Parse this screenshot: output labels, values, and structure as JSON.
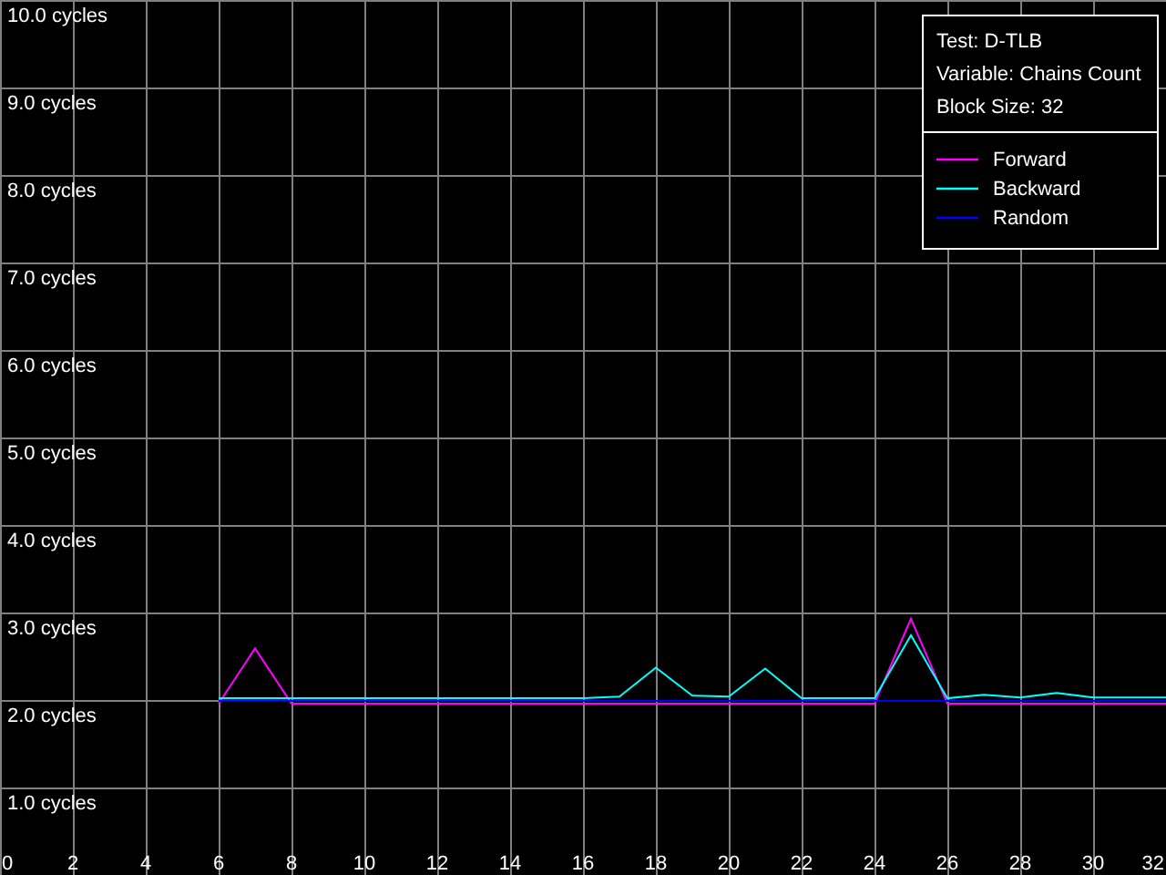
{
  "chart": {
    "info": [
      "Test: D-TLB",
      "Variable: Chains Count",
      "Block Size: 32"
    ],
    "chart_data": {
      "type": "line",
      "x": [
        6,
        7,
        8,
        9,
        10,
        11,
        12,
        13,
        14,
        15,
        16,
        17,
        18,
        19,
        20,
        21,
        22,
        23,
        24,
        25,
        26,
        27,
        28,
        29,
        30,
        31,
        32
      ],
      "series": [
        {
          "name": "Forward",
          "color": "#ff00ff",
          "values": [
            1.97,
            2.6,
            1.97,
            1.97,
            1.97,
            1.97,
            1.97,
            1.97,
            1.97,
            1.97,
            1.97,
            1.97,
            1.97,
            1.97,
            1.97,
            1.97,
            1.97,
            1.97,
            1.97,
            2.94,
            1.97,
            1.97,
            1.97,
            1.97,
            1.97,
            1.97,
            1.97
          ]
        },
        {
          "name": "Backward",
          "color": "#00ffff",
          "values": [
            2.03,
            2.03,
            2.03,
            2.03,
            2.03,
            2.03,
            2.03,
            2.03,
            2.03,
            2.03,
            2.03,
            2.05,
            2.38,
            2.06,
            2.05,
            2.37,
            2.03,
            2.03,
            2.03,
            2.75,
            2.03,
            2.07,
            2.04,
            2.09,
            2.04,
            2.04,
            2.04
          ]
        },
        {
          "name": "Random",
          "color": "#0000ff",
          "values": [
            2.0,
            2.0,
            2.0,
            2.0,
            2.0,
            2.0,
            2.0,
            2.0,
            2.0,
            2.0,
            2.0,
            2.0,
            2.0,
            2.0,
            2.0,
            2.0,
            2.0,
            2.0,
            2.0,
            2.0,
            2.0,
            2.0,
            2.0,
            2.0,
            2.0,
            2.0,
            2.0
          ]
        }
      ],
      "xlim": [
        0,
        32
      ],
      "ylim": [
        0,
        10
      ],
      "grid": true,
      "legend": true,
      "xticks": [
        0,
        2,
        4,
        6,
        8,
        10,
        12,
        14,
        16,
        18,
        20,
        22,
        24,
        26,
        28,
        30,
        32
      ],
      "yticks": [
        {
          "value": 1,
          "label": "1.0 cycles"
        },
        {
          "value": 2,
          "label": "2.0 cycles"
        },
        {
          "value": 3,
          "label": "3.0 cycles"
        },
        {
          "value": 4,
          "label": "4.0 cycles"
        },
        {
          "value": 5,
          "label": "5.0 cycles"
        },
        {
          "value": 6,
          "label": "6.0 cycles"
        },
        {
          "value": 7,
          "label": "7.0 cycles"
        },
        {
          "value": 8,
          "label": "8.0 cycles"
        },
        {
          "value": 9,
          "label": "9.0 cycles"
        },
        {
          "value": 10,
          "label": "10.0 cycles"
        }
      ]
    }
  }
}
